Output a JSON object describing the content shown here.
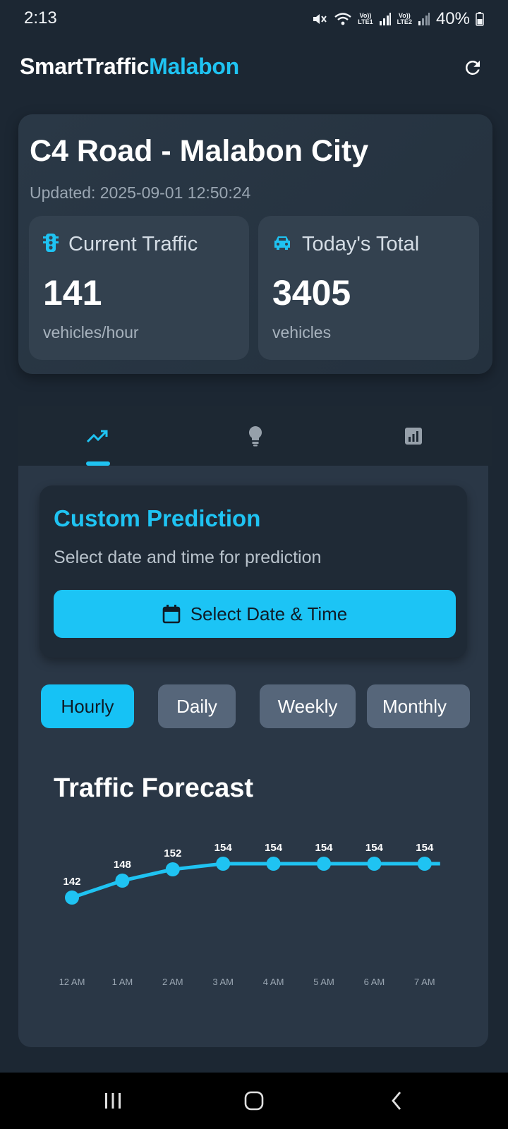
{
  "status": {
    "time": "2:13",
    "battery": "40%",
    "sim1": "Vo)) LTE1",
    "sim2": "Vo)) LTE2"
  },
  "app": {
    "title_part1": "SmartTraffic",
    "title_part2": "Malabon",
    "accent": "#1fc3f2"
  },
  "location": {
    "title": "C4 Road - Malabon City",
    "updated": "Updated: 2025-09-01 12:50:24",
    "current": {
      "label": "Current Traffic",
      "value": "141",
      "unit": "vehicles/hour",
      "icon": "traffic-light-icon"
    },
    "total": {
      "label": "Today's Total",
      "value": "3405",
      "unit": "vehicles",
      "icon": "car-icon"
    }
  },
  "tabs": [
    {
      "icon": "trending-up-icon",
      "selected": true
    },
    {
      "icon": "lightbulb-icon",
      "selected": false
    },
    {
      "icon": "bar-chart-icon",
      "selected": false
    }
  ],
  "prediction": {
    "title": "Custom Prediction",
    "subtitle": "Select date and time for prediction",
    "button_label": "Select Date & Time",
    "button_icon": "calendar-icon"
  },
  "periods": [
    {
      "label": "Hourly",
      "selected": true
    },
    {
      "label": "Daily",
      "selected": false
    },
    {
      "label": "Weekly",
      "selected": false
    },
    {
      "label": "Monthly",
      "selected": false
    }
  ],
  "forecast": {
    "title": "Traffic Forecast"
  },
  "chart_data": {
    "type": "line",
    "title": "Traffic Forecast",
    "categories": [
      "12 AM",
      "1 AM",
      "2 AM",
      "3 AM",
      "4 AM",
      "5 AM",
      "6 AM",
      "7 AM"
    ],
    "values": [
      142,
      148,
      152,
      154,
      154,
      154,
      154,
      154
    ],
    "ylim": [
      120,
      160
    ],
    "grid": false,
    "line_color": "#1fc3f2",
    "data_labels": true
  }
}
